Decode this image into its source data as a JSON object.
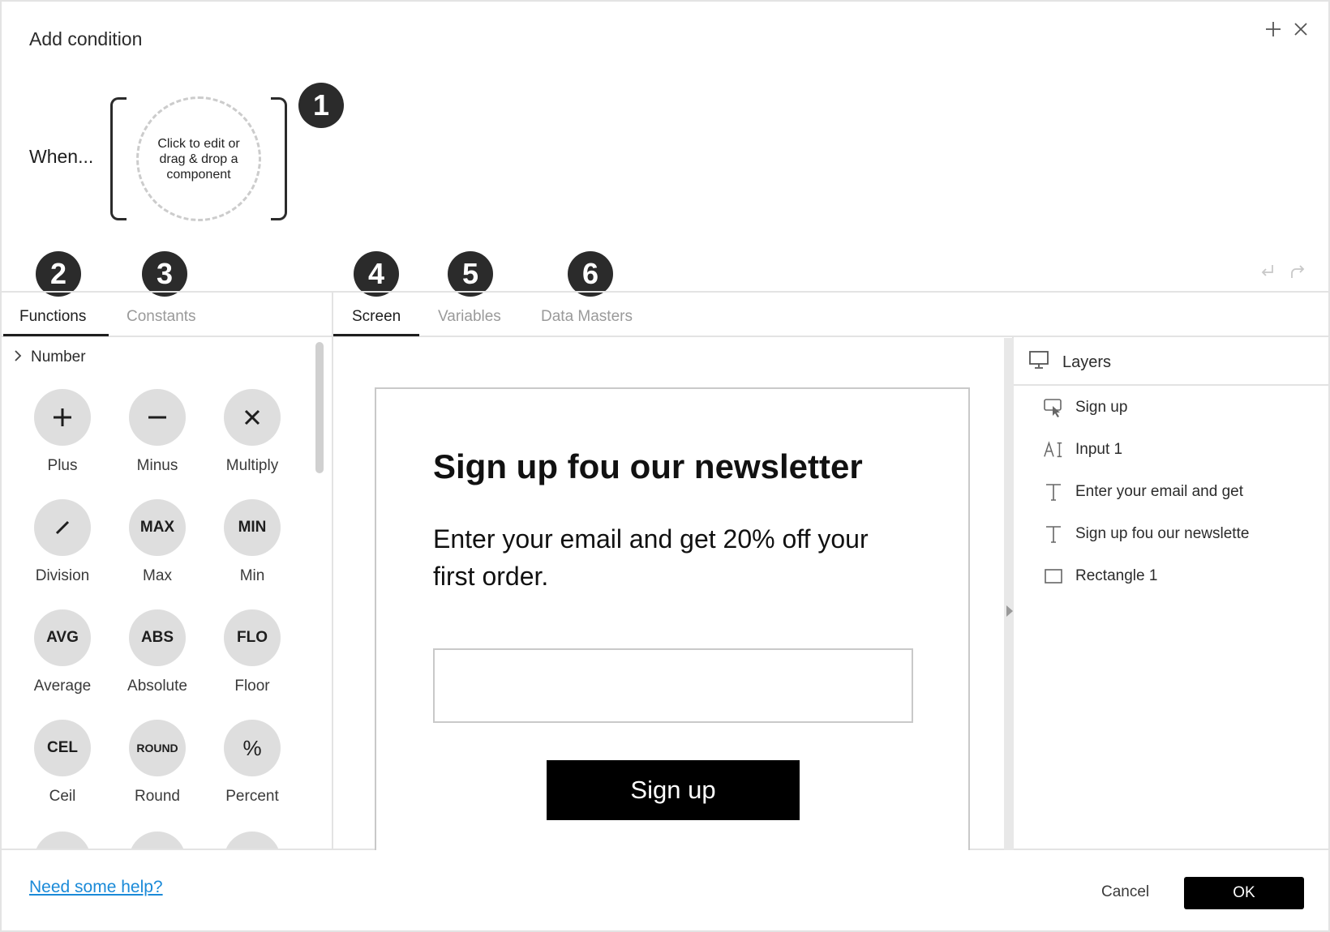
{
  "dialog": {
    "title": "Add condition"
  },
  "condition": {
    "when_label": "When...",
    "drop_zone_text": "Click to edit or drag & drop a component"
  },
  "markers": [
    "1",
    "2",
    "3",
    "4",
    "5",
    "6"
  ],
  "left_panel": {
    "tabs": [
      {
        "label": "Functions",
        "active": true
      },
      {
        "label": "Constants",
        "active": false
      }
    ],
    "category": "Number",
    "functions": [
      {
        "symbol": "+",
        "label": "Plus"
      },
      {
        "symbol": "−",
        "label": "Minus"
      },
      {
        "symbol": "✕",
        "label": "Multiply"
      },
      {
        "symbol": "/",
        "label": "Division"
      },
      {
        "symbol": "MAX",
        "label": "Max"
      },
      {
        "symbol": "MIN",
        "label": "Min"
      },
      {
        "symbol": "AVG",
        "label": "Average"
      },
      {
        "symbol": "ABS",
        "label": "Absolute"
      },
      {
        "symbol": "FLO",
        "label": "Floor"
      },
      {
        "symbol": "CEL",
        "label": "Ceil"
      },
      {
        "symbol": "ROUND",
        "label": "Round"
      },
      {
        "symbol": "%",
        "label": "Percent"
      }
    ]
  },
  "center_panel": {
    "tabs": [
      {
        "label": "Screen",
        "active": true
      },
      {
        "label": "Variables",
        "active": false
      },
      {
        "label": "Data Masters",
        "active": false
      }
    ],
    "screen": {
      "heading": "Sign up fou our newsletter",
      "description": "Enter your email and get 20% off your first order.",
      "email_input_value": "",
      "button_label": "Sign up"
    }
  },
  "layers_panel": {
    "title": "Layers",
    "items": [
      {
        "icon": "button-icon",
        "label": "Sign up"
      },
      {
        "icon": "input-icon",
        "label": "Input 1"
      },
      {
        "icon": "text-icon",
        "label": "Enter your email and get"
      },
      {
        "icon": "text-icon",
        "label": "Sign up fou our newslette"
      },
      {
        "icon": "rectangle-icon",
        "label": "Rectangle 1"
      }
    ]
  },
  "footer": {
    "help_link": "Need some help?",
    "cancel_label": "Cancel",
    "ok_label": "OK"
  },
  "colors": {
    "accent_link": "#1a8ad8",
    "primary_button": "#000000",
    "marker_bg": "#2b2b2b",
    "function_circle": "#dedede"
  }
}
